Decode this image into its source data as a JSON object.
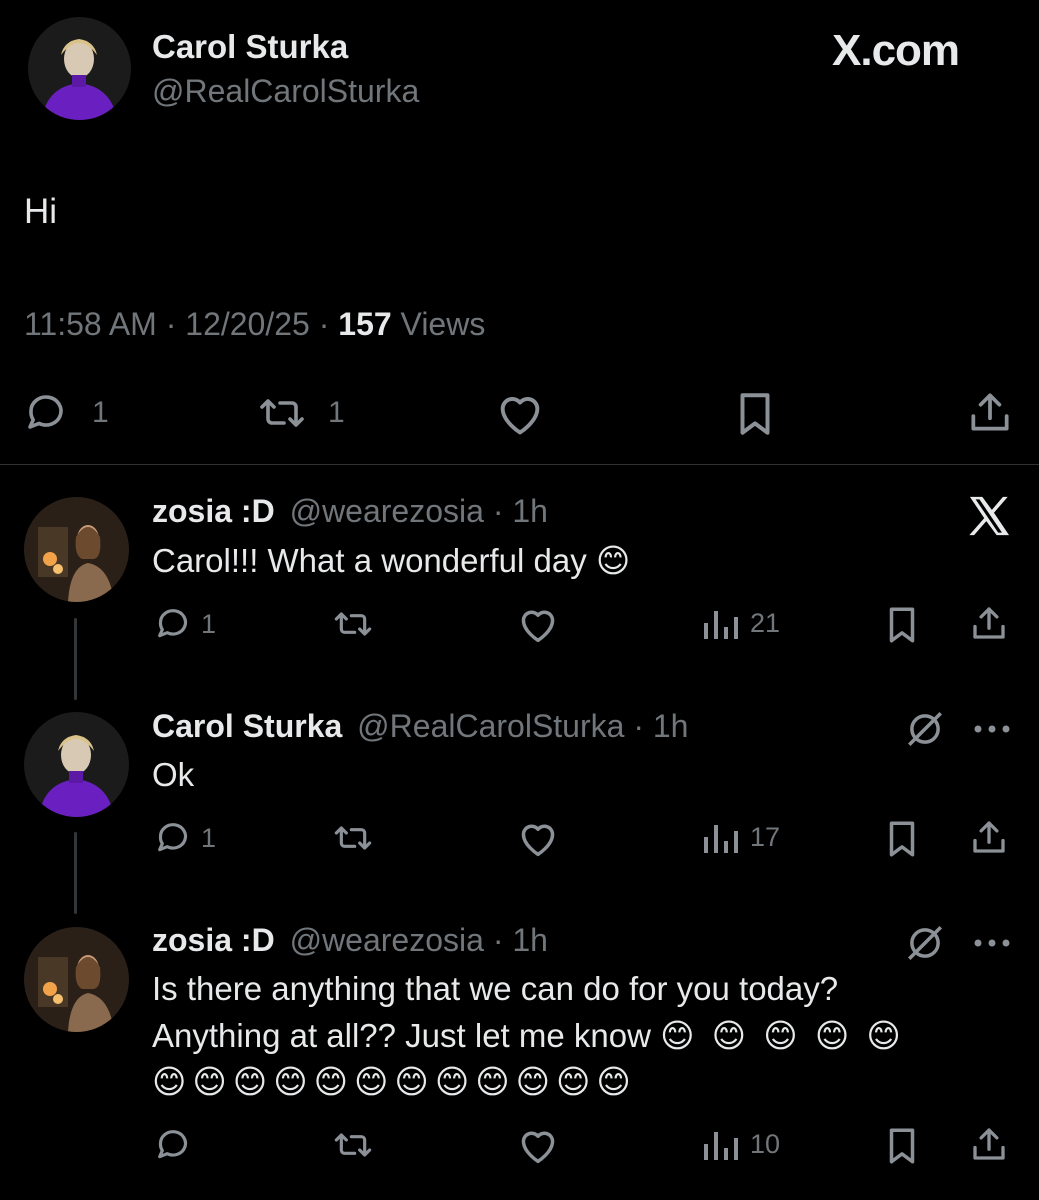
{
  "main_tweet": {
    "author_name": "Carol Sturka",
    "handle": "@RealCarolSturka",
    "site_label": "X.com",
    "text": "Hi",
    "time": "11:58 AM",
    "date": "12/20/25",
    "views_count": "157",
    "views_label": "Views",
    "reply_count": "1",
    "retweet_count": "1"
  },
  "replies": [
    {
      "author_name": "zosia :D",
      "handle": "@wearezosia",
      "age": "1h",
      "text": "Carol!!! What a wonderful day",
      "emoji": "😊",
      "reply_count": "1",
      "views": "21"
    },
    {
      "author_name": "Carol Sturka",
      "handle": "@RealCarolSturka",
      "age": "1h",
      "text": "Ok",
      "reply_count": "1",
      "views": "17"
    },
    {
      "author_name": "zosia :D",
      "handle": "@wearezosia",
      "age": "1h",
      "text_line1": "Is there anything that we can do for you today?",
      "text_line2": "Anything at all?? Just let me know",
      "emojis_line2": "😊 😊 😊 😊 😊",
      "emojis_line3": "😊😊😊😊😊😊😊😊😊😊😊😊",
      "views": "10"
    }
  ],
  "icons": {
    "grok_logo": "x-logo-icon",
    "slashed_circle": "grok-icon",
    "more": "more-icon"
  },
  "colors": {
    "background": "#000000",
    "text": "#e7e9ea",
    "muted": "#71767b",
    "avatar_purple": "#6a1fc0"
  }
}
